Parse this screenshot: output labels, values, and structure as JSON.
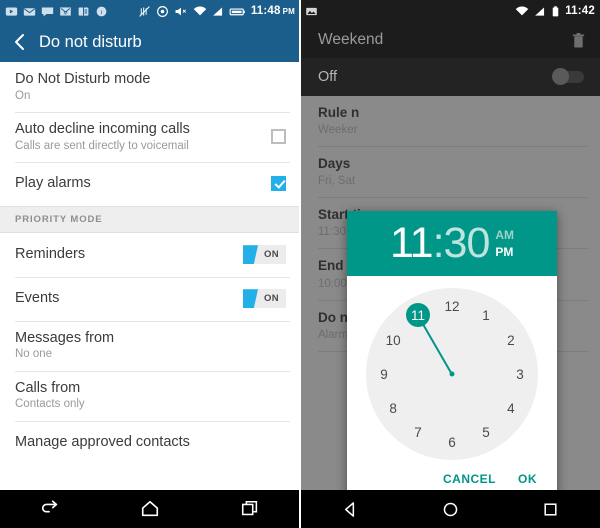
{
  "left_phone": {
    "status_bar": {
      "time": "11:48",
      "ampm": "PM",
      "left_icons": [
        "back-badge-icon",
        "envelope-icon",
        "chat-bubble-icon",
        "gmail-icon",
        "flipboard-icon",
        "info-circle-icon"
      ],
      "right_icons": [
        "no-vibrate-icon",
        "dnd-circle-icon",
        "volume-mute-icon",
        "wifi-icon",
        "signal-icon",
        "battery-icon"
      ]
    },
    "appbar": {
      "back_label": "back-arrow-icon",
      "title": "Do not disturb"
    },
    "rows": [
      {
        "primary": "Do Not Disturb mode",
        "secondary": "On",
        "control": "none"
      },
      {
        "primary": "Auto decline incoming calls",
        "secondary": "Calls are sent directly to voicemail",
        "control": "checkbox",
        "checked": false
      },
      {
        "primary": "Play alarms",
        "secondary": "",
        "control": "checkbox",
        "checked": true
      }
    ],
    "section_header": "PRIORITY MODE",
    "priority_rows": [
      {
        "primary": "Reminders",
        "secondary": "",
        "control": "toggle",
        "toggle_label": "ON"
      },
      {
        "primary": "Events",
        "secondary": "",
        "control": "toggle",
        "toggle_label": "ON"
      },
      {
        "primary": "Messages from",
        "secondary": "No one",
        "control": "none"
      },
      {
        "primary": "Calls from",
        "secondary": "Contacts only",
        "control": "none"
      },
      {
        "primary": "Manage approved contacts",
        "secondary": "",
        "control": "none"
      }
    ],
    "navbar": [
      "back-icon",
      "home-icon",
      "recents-icon"
    ]
  },
  "right_phone": {
    "status_bar": {
      "time": "11:42",
      "left_icons": [
        "screenshot-icon"
      ],
      "right_icons": [
        "wifi-icon",
        "signal-icon",
        "battery-icon"
      ]
    },
    "appbar": {
      "title": "Weekend",
      "delete_icon": "trash-icon"
    },
    "off_bar": {
      "label": "Off",
      "switch_state": "off"
    },
    "rows": [
      {
        "primary": "Rule n",
        "secondary": "Weeker"
      },
      {
        "primary": "Days",
        "secondary": "Fri, Sat"
      },
      {
        "primary": "Start ti",
        "secondary": "11:30 P"
      },
      {
        "primary": "End tim",
        "secondary": "10:00 A"
      },
      {
        "primary": "Do not",
        "secondary": "Alarms"
      }
    ],
    "dialog": {
      "hour": "11",
      "separator": ":",
      "minute": "30",
      "am_label": "AM",
      "pm_label": "PM",
      "selected_meridiem": "PM",
      "selected_hour": 11,
      "clock_numbers": [
        "1",
        "2",
        "3",
        "4",
        "5",
        "6",
        "7",
        "8",
        "9",
        "10",
        "11",
        "12"
      ],
      "cancel_label": "CANCEL",
      "ok_label": "OK"
    },
    "navbar": [
      "back-triangle-icon",
      "home-circle-icon",
      "recents-square-icon"
    ]
  },
  "colors": {
    "left_accent": "#1b5e8c",
    "checkbox_on": "#23b0e8",
    "teal": "#009688",
    "dark_bar": "#1c1c1c",
    "scrim_gray": "#8a8a8a"
  }
}
